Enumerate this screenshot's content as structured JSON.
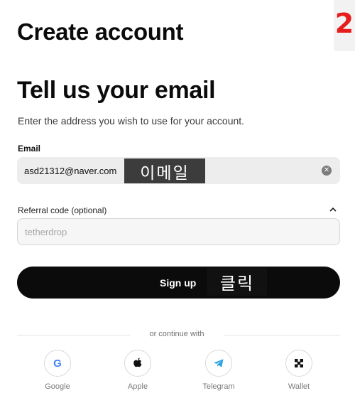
{
  "step_badge": "2",
  "header": {
    "title": "Create account"
  },
  "form": {
    "heading": "Tell us your email",
    "subtitle": "Enter the address you wish to use for your account.",
    "email": {
      "label": "Email",
      "value": "asd21312@naver.com",
      "annotation": "이메일"
    },
    "referral": {
      "label": "Referral code (optional)",
      "placeholder": "tetherdrop"
    },
    "submit": {
      "label": "Sign up",
      "annotation": "클릭"
    }
  },
  "divider_text": "or continue with",
  "social": [
    {
      "label": "Google",
      "icon": "google-icon"
    },
    {
      "label": "Apple",
      "icon": "apple-icon"
    },
    {
      "label": "Telegram",
      "icon": "telegram-icon"
    },
    {
      "label": "Wallet",
      "icon": "wallet-icon"
    }
  ],
  "colors": {
    "primary_button": "#0b0b0b",
    "step_badge": "#e81c1c",
    "input_bg": "#ededed",
    "telegram": "#2aa3e1"
  }
}
